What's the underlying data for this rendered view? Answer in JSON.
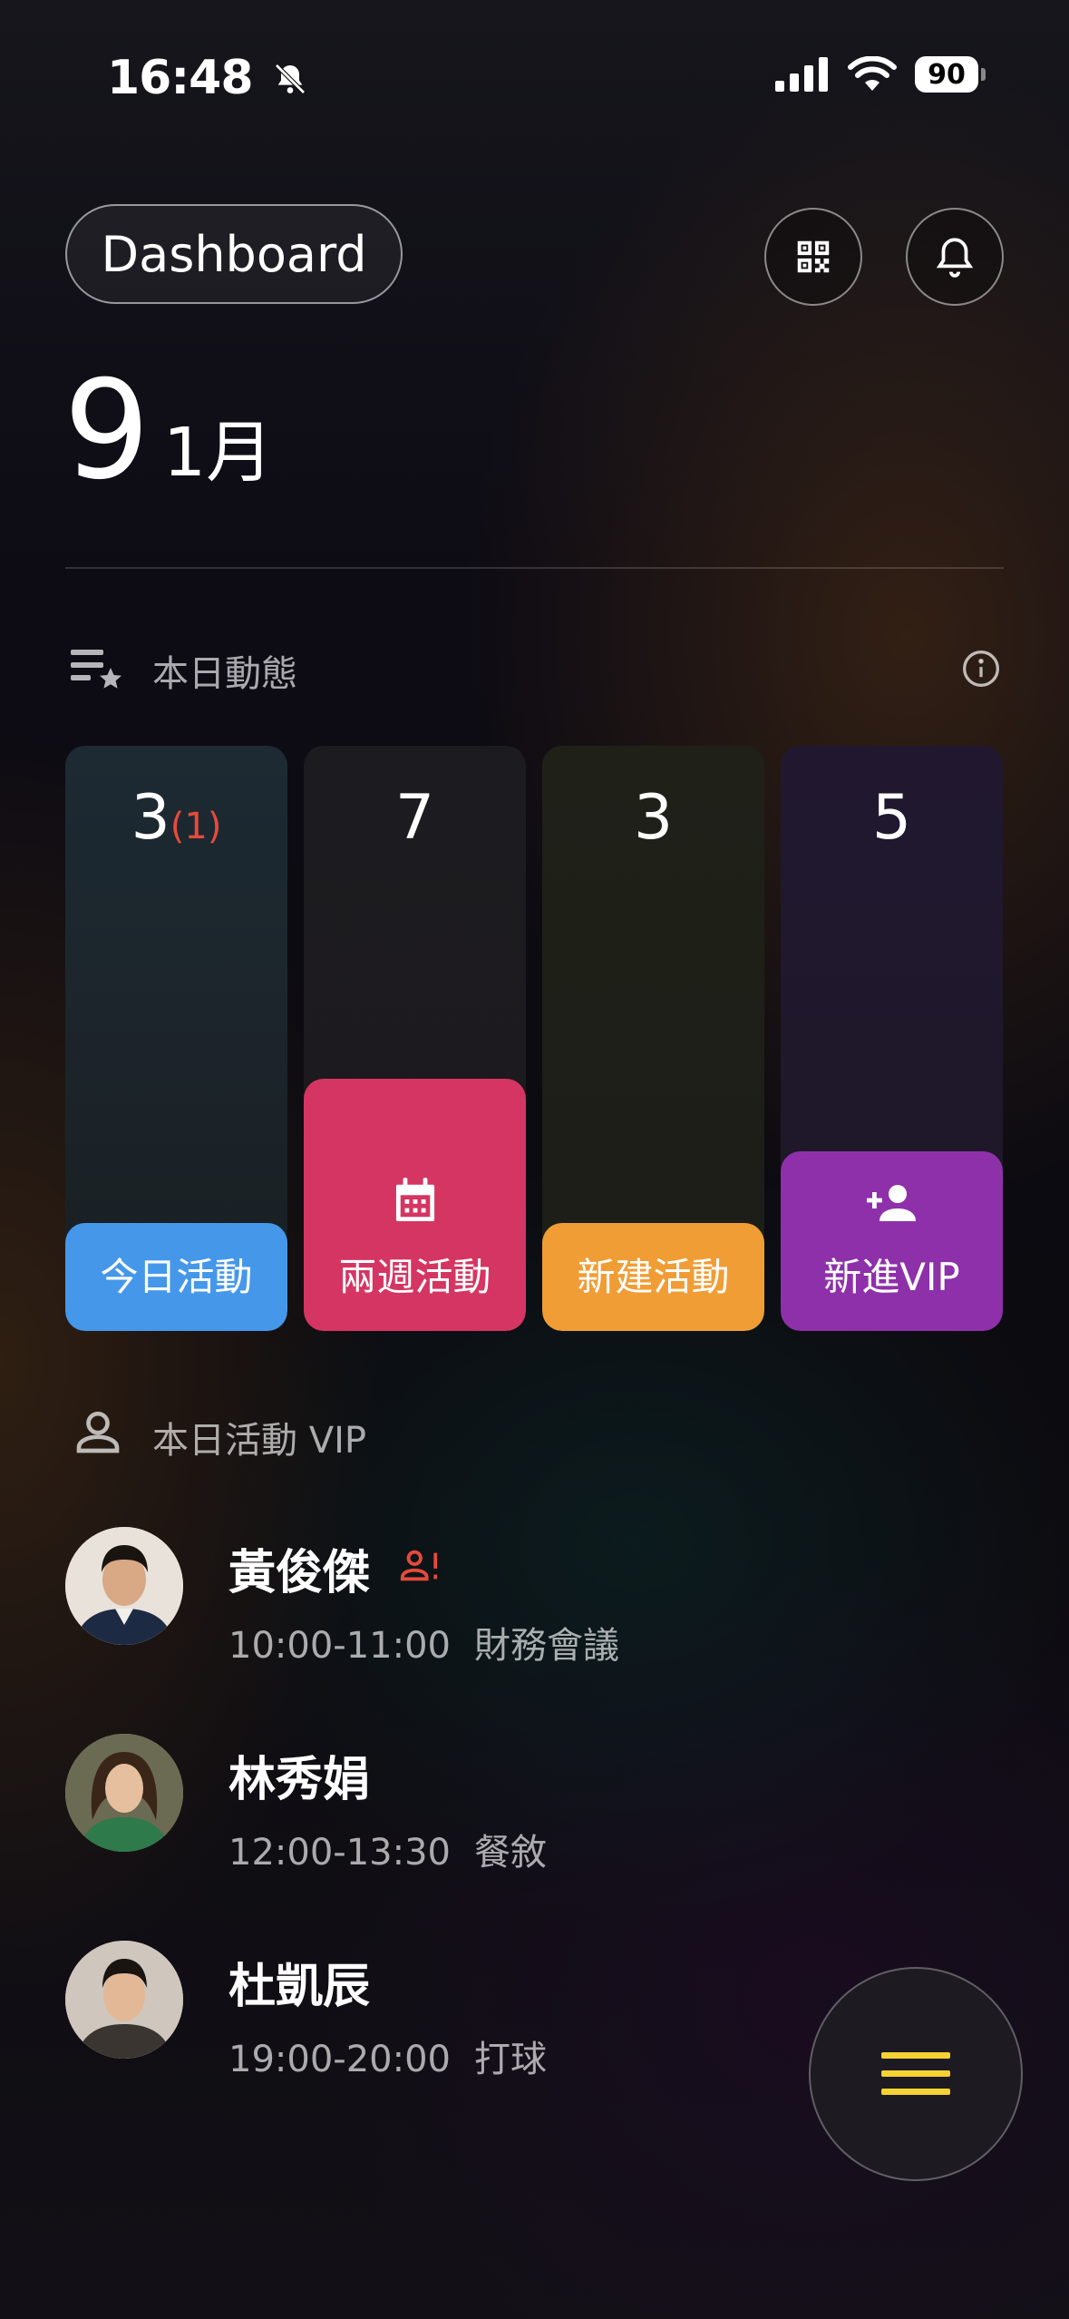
{
  "status_bar": {
    "time": "16:48",
    "battery": "90"
  },
  "header": {
    "title": "Dashboard"
  },
  "date": {
    "day": "9",
    "month": "1月"
  },
  "today_activity": {
    "title": "本日動態",
    "cards": [
      {
        "count": "3",
        "sub_count": "(1)",
        "label": "今日活動",
        "icon": "calendar-today-icon",
        "color": "#4597ea",
        "fill_fraction": 0.185
      },
      {
        "count": "7",
        "sub_count": "",
        "label": "兩週活動",
        "icon": "calendar-grid-icon",
        "color": "#d53562",
        "fill_fraction": 0.431
      },
      {
        "count": "3",
        "sub_count": "",
        "label": "新建活動",
        "icon": "calendar-add-icon",
        "color": "#f09d35",
        "fill_fraction": 0.185
      },
      {
        "count": "5",
        "sub_count": "",
        "label": "新進VIP",
        "icon": "person-add-icon",
        "color": "#8e30aa",
        "fill_fraction": 0.307
      }
    ]
  },
  "vip_section": {
    "title": "本日活動 VIP",
    "items": [
      {
        "name": "黃俊傑",
        "time": "10:00-11:00",
        "event": "財務會議",
        "flagged": true
      },
      {
        "name": "林秀娟",
        "time": "12:00-13:30",
        "event": "餐敘",
        "flagged": false
      },
      {
        "name": "杜凱辰",
        "time": "19:00-20:00",
        "event": "打球",
        "flagged": false
      }
    ]
  },
  "colors": {
    "flag": "#e64a3a",
    "menu": "#f5d233"
  }
}
